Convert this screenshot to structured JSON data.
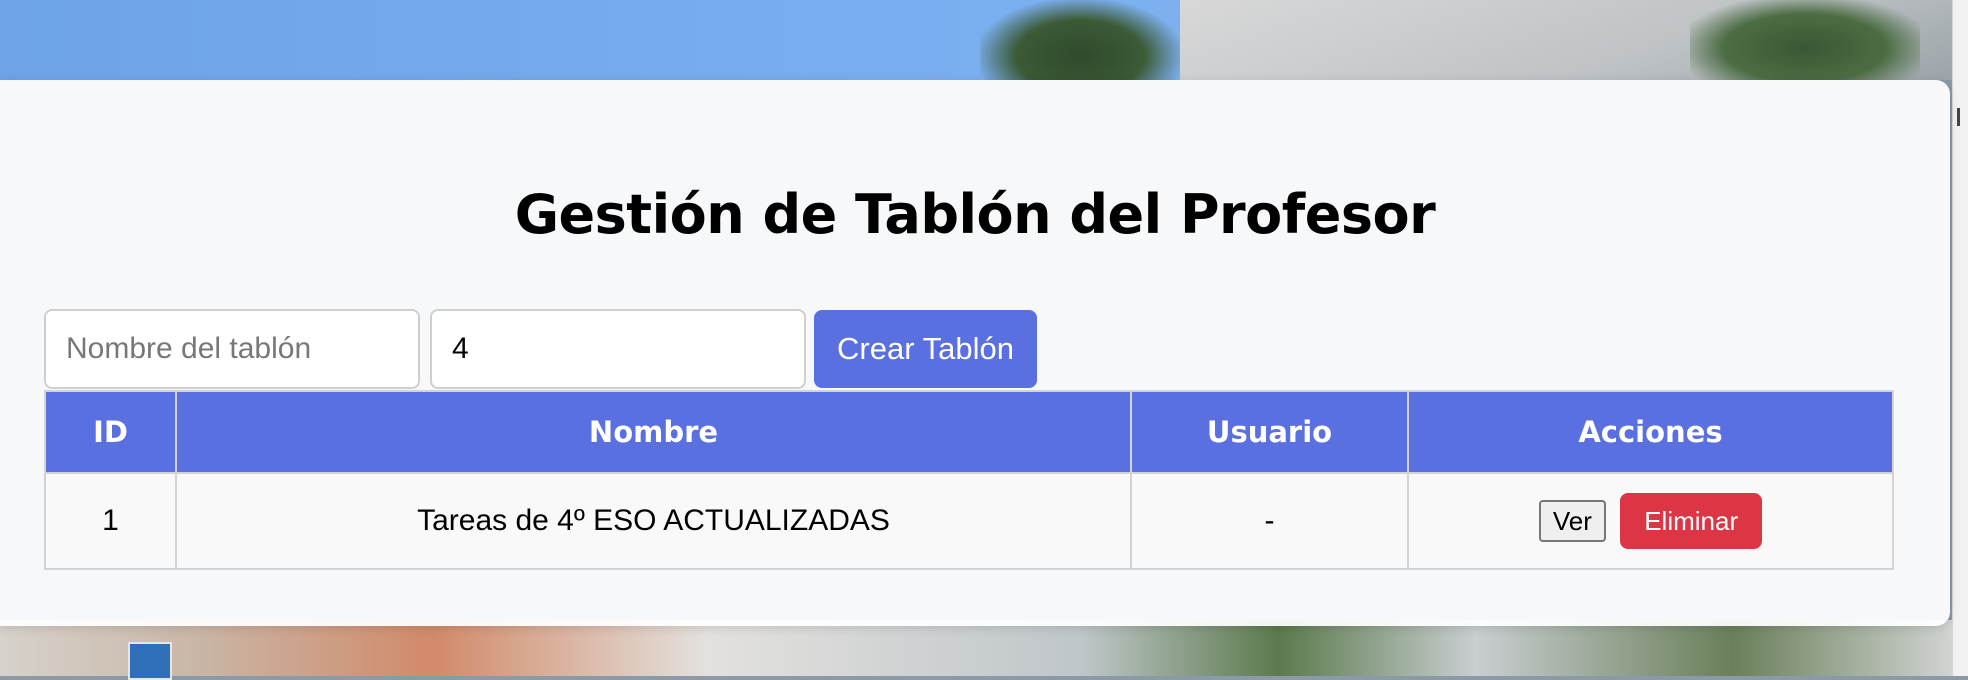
{
  "page": {
    "title": "Gestión de Tablón del Profesor"
  },
  "form": {
    "name_placeholder": "Nombre del tablón",
    "name_value": "",
    "user_value": "4",
    "create_label": "Crear Tablón"
  },
  "table": {
    "headers": [
      "ID",
      "Nombre",
      "Usuario",
      "Acciones"
    ],
    "rows": [
      {
        "id": "1",
        "name": "Tareas de 4º ESO ACTUALIZADAS",
        "user": "-",
        "view_label": "Ver",
        "delete_label": "Eliminar"
      }
    ]
  },
  "colors": {
    "accent": "#5a6fe0",
    "danger": "#dc3545"
  }
}
